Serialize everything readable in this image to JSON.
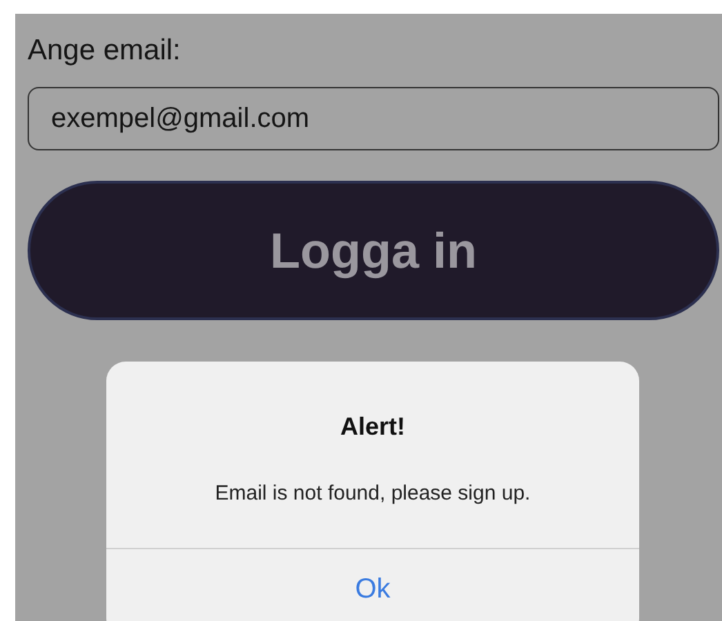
{
  "form": {
    "label": "Ange email:",
    "email_value": "exempel@gmail.com",
    "login_button": "Logga in"
  },
  "alert": {
    "title": "Alert!",
    "message": "Email is not found, please sign up.",
    "button": "Ok"
  }
}
